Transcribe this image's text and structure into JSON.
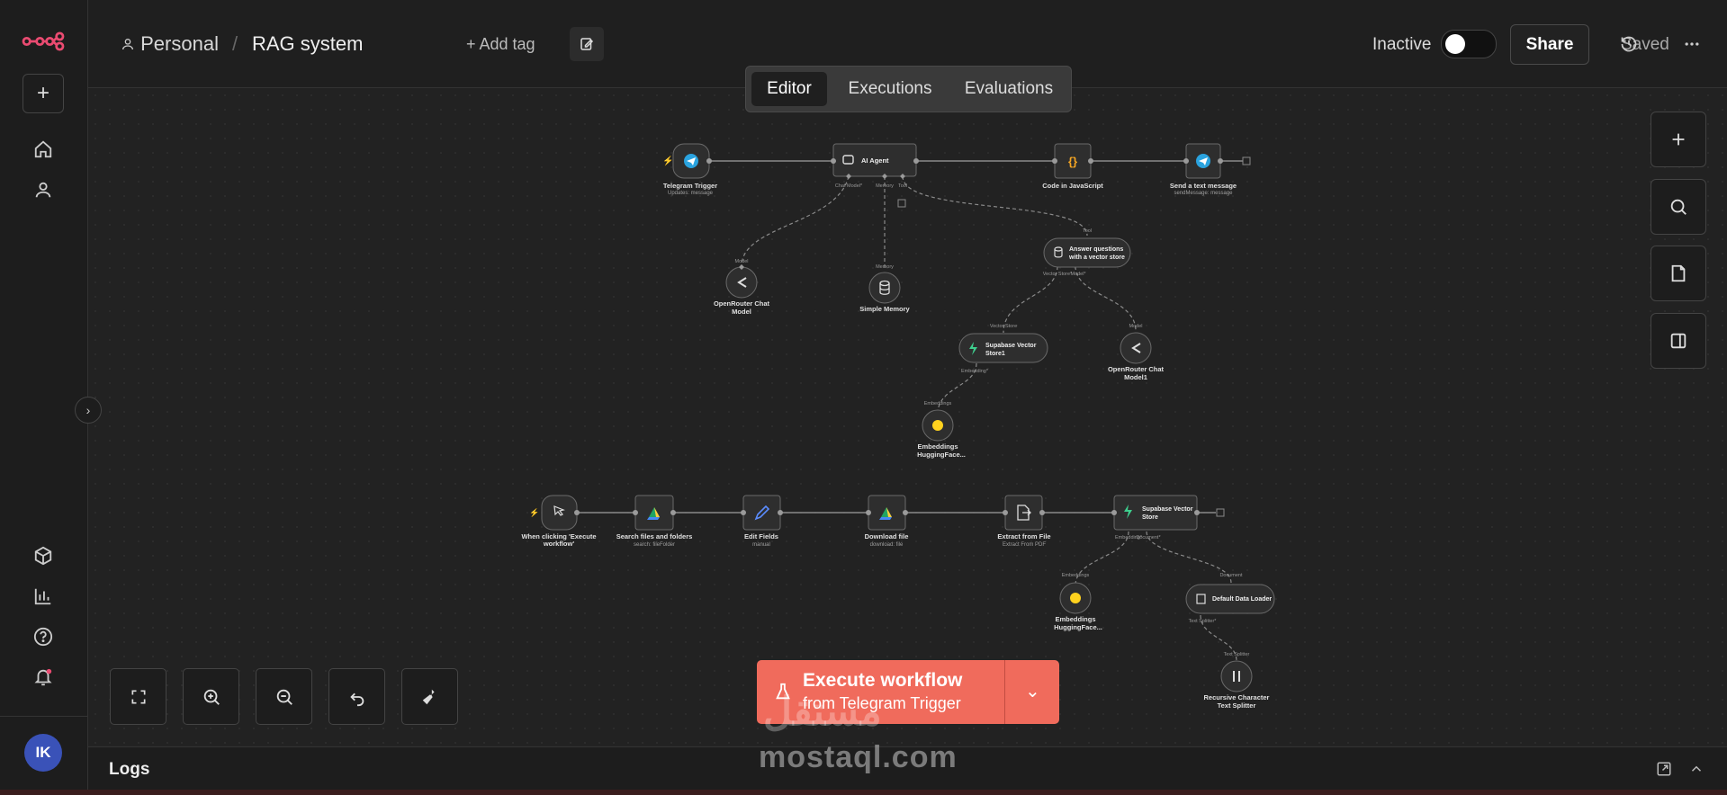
{
  "header": {
    "project": "Personal",
    "separator": "/",
    "workflow_name": "RAG system",
    "add_tag": "+ Add tag",
    "status": "Inactive",
    "share": "Share",
    "saved": "Saved"
  },
  "tabs": [
    {
      "label": "Editor",
      "active": true
    },
    {
      "label": "Executions",
      "active": false
    },
    {
      "label": "Evaluations",
      "active": false
    }
  ],
  "sidebar": {
    "avatar_initials": "IK",
    "icons": [
      "n8n-logo-icon",
      "plus-icon",
      "home-icon",
      "user-icon",
      "cube-icon",
      "chart-icon",
      "help-icon",
      "bell-icon"
    ]
  },
  "nodes": {
    "telegram_trigger": {
      "title": "Telegram Trigger",
      "sub": "Updates: message"
    },
    "ai_agent": {
      "title": "AI Agent",
      "ports": [
        "Chat Model*",
        "Memory",
        "Tool"
      ]
    },
    "code_js": {
      "title": "Code in JavaScript"
    },
    "send_msg": {
      "title": "Send a text message",
      "sub": "sendMessage: message"
    },
    "openrouter1": {
      "title": "OpenRouter Chat",
      "title2": "Model",
      "port": "Model"
    },
    "simple_memory": {
      "title": "Simple Memory",
      "port": "Memory"
    },
    "answer_vs": {
      "title": "Answer questions",
      "title2": "with a vector store",
      "port_top": "Tool",
      "ports": [
        "Vector Store*",
        "Model*"
      ]
    },
    "supabase_vs1": {
      "title": "Supabase Vector",
      "title2": "Store1",
      "port_top": "Vector Store",
      "port_bottom": "Embedding*"
    },
    "openrouter2": {
      "title": "OpenRouter Chat",
      "title2": "Model1",
      "port": "Model"
    },
    "embed1": {
      "title": "Embeddings",
      "title2": "HuggingFace...",
      "port": "Embeddings"
    },
    "manual_trigger": {
      "title": "When clicking 'Execute",
      "title2": "workflow'"
    },
    "search_files": {
      "title": "Search files and folders",
      "sub": "search: fileFolder"
    },
    "edit_fields": {
      "title": "Edit Fields",
      "sub": "manual"
    },
    "download_file": {
      "title": "Download file",
      "sub": "download: file"
    },
    "extract_file": {
      "title": "Extract from File",
      "sub": "Extract From PDF"
    },
    "supabase_vs2": {
      "title": "Supabase Vector",
      "title2": "Store",
      "ports": [
        "Embedding*",
        "Document*"
      ]
    },
    "embed2": {
      "title": "Embeddings",
      "title2": "HuggingFace...",
      "port": "Embeddings"
    },
    "data_loader": {
      "title": "Default Data Loader",
      "port_top": "Document",
      "port_bottom": "Text Splitter*"
    },
    "text_splitter": {
      "title": "Recursive Character",
      "title2": "Text Splitter",
      "port": "Text Splitter"
    }
  },
  "execute": {
    "line1": "Execute workflow",
    "line2": "from Telegram Trigger"
  },
  "logs": {
    "title": "Logs"
  },
  "watermark": {
    "arabic": "مستقل",
    "latin": "mostaql.com"
  },
  "colors": {
    "accent": "#f06b5c",
    "telegram": "#2aa3df",
    "supabase": "#3ecf8e",
    "code": "#f6a623",
    "hf": "#ffd21e",
    "bell_badge": "#ea4b71"
  }
}
